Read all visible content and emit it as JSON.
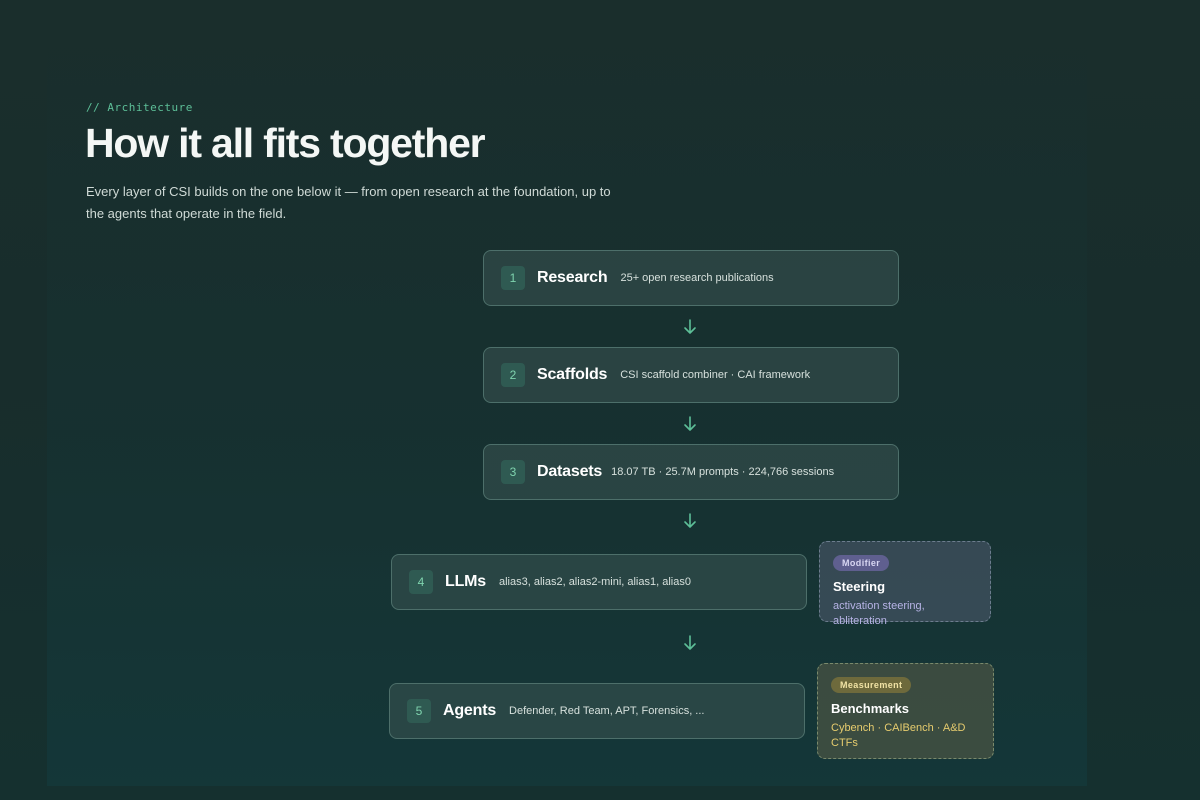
{
  "header": {
    "eyebrow": "// Architecture",
    "title": "How it all fits together",
    "subtitle": "Every layer of CSI builds on the one below it — from open research at the foundation, up to the agents that operate in the field."
  },
  "layers": [
    {
      "number": "1",
      "name": "Research",
      "description": "25+ open research publications"
    },
    {
      "number": "2",
      "name": "Scaffolds",
      "description": "CSI scaffold combiner · CAI framework"
    },
    {
      "number": "3",
      "name": "Datasets",
      "description": "18.07 TB · 25.7M prompts · 224,766 sessions"
    },
    {
      "number": "4",
      "name": "LLMs",
      "description": "alias3, alias2, alias2-mini, alias1, alias0"
    },
    {
      "number": "5",
      "name": "Agents",
      "description": "Defender, Red Team, APT, Forensics, ..."
    }
  ],
  "side_cards": {
    "steering": {
      "badge": "Modifier",
      "title": "Steering",
      "description": "activation steering, abliteration"
    },
    "benchmarks": {
      "badge": "Measurement",
      "title": "Benchmarks",
      "description": "Cybench · CAIBench · A&D CTFs"
    }
  },
  "colors": {
    "accent": "#5dbf98",
    "background": "#182c2b",
    "modifier_badge": "#5f5f8f",
    "measurement_badge": "#6e6a3c"
  },
  "icons": {
    "connector": "arrow-down-icon"
  }
}
